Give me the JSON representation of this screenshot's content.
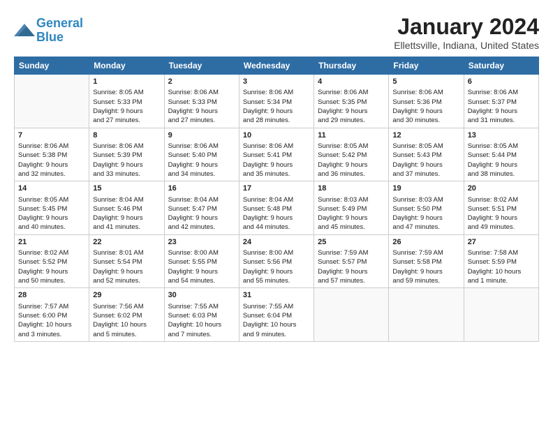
{
  "header": {
    "logo_line1": "General",
    "logo_line2": "Blue",
    "month": "January 2024",
    "location": "Ellettsville, Indiana, United States"
  },
  "weekdays": [
    "Sunday",
    "Monday",
    "Tuesday",
    "Wednesday",
    "Thursday",
    "Friday",
    "Saturday"
  ],
  "weeks": [
    [
      {
        "day": "",
        "text": ""
      },
      {
        "day": "1",
        "text": "Sunrise: 8:05 AM\nSunset: 5:33 PM\nDaylight: 9 hours\nand 27 minutes."
      },
      {
        "day": "2",
        "text": "Sunrise: 8:06 AM\nSunset: 5:33 PM\nDaylight: 9 hours\nand 27 minutes."
      },
      {
        "day": "3",
        "text": "Sunrise: 8:06 AM\nSunset: 5:34 PM\nDaylight: 9 hours\nand 28 minutes."
      },
      {
        "day": "4",
        "text": "Sunrise: 8:06 AM\nSunset: 5:35 PM\nDaylight: 9 hours\nand 29 minutes."
      },
      {
        "day": "5",
        "text": "Sunrise: 8:06 AM\nSunset: 5:36 PM\nDaylight: 9 hours\nand 30 minutes."
      },
      {
        "day": "6",
        "text": "Sunrise: 8:06 AM\nSunset: 5:37 PM\nDaylight: 9 hours\nand 31 minutes."
      }
    ],
    [
      {
        "day": "7",
        "text": "Sunrise: 8:06 AM\nSunset: 5:38 PM\nDaylight: 9 hours\nand 32 minutes."
      },
      {
        "day": "8",
        "text": "Sunrise: 8:06 AM\nSunset: 5:39 PM\nDaylight: 9 hours\nand 33 minutes."
      },
      {
        "day": "9",
        "text": "Sunrise: 8:06 AM\nSunset: 5:40 PM\nDaylight: 9 hours\nand 34 minutes."
      },
      {
        "day": "10",
        "text": "Sunrise: 8:06 AM\nSunset: 5:41 PM\nDaylight: 9 hours\nand 35 minutes."
      },
      {
        "day": "11",
        "text": "Sunrise: 8:05 AM\nSunset: 5:42 PM\nDaylight: 9 hours\nand 36 minutes."
      },
      {
        "day": "12",
        "text": "Sunrise: 8:05 AM\nSunset: 5:43 PM\nDaylight: 9 hours\nand 37 minutes."
      },
      {
        "day": "13",
        "text": "Sunrise: 8:05 AM\nSunset: 5:44 PM\nDaylight: 9 hours\nand 38 minutes."
      }
    ],
    [
      {
        "day": "14",
        "text": "Sunrise: 8:05 AM\nSunset: 5:45 PM\nDaylight: 9 hours\nand 40 minutes."
      },
      {
        "day": "15",
        "text": "Sunrise: 8:04 AM\nSunset: 5:46 PM\nDaylight: 9 hours\nand 41 minutes."
      },
      {
        "day": "16",
        "text": "Sunrise: 8:04 AM\nSunset: 5:47 PM\nDaylight: 9 hours\nand 42 minutes."
      },
      {
        "day": "17",
        "text": "Sunrise: 8:04 AM\nSunset: 5:48 PM\nDaylight: 9 hours\nand 44 minutes."
      },
      {
        "day": "18",
        "text": "Sunrise: 8:03 AM\nSunset: 5:49 PM\nDaylight: 9 hours\nand 45 minutes."
      },
      {
        "day": "19",
        "text": "Sunrise: 8:03 AM\nSunset: 5:50 PM\nDaylight: 9 hours\nand 47 minutes."
      },
      {
        "day": "20",
        "text": "Sunrise: 8:02 AM\nSunset: 5:51 PM\nDaylight: 9 hours\nand 49 minutes."
      }
    ],
    [
      {
        "day": "21",
        "text": "Sunrise: 8:02 AM\nSunset: 5:52 PM\nDaylight: 9 hours\nand 50 minutes."
      },
      {
        "day": "22",
        "text": "Sunrise: 8:01 AM\nSunset: 5:54 PM\nDaylight: 9 hours\nand 52 minutes."
      },
      {
        "day": "23",
        "text": "Sunrise: 8:00 AM\nSunset: 5:55 PM\nDaylight: 9 hours\nand 54 minutes."
      },
      {
        "day": "24",
        "text": "Sunrise: 8:00 AM\nSunset: 5:56 PM\nDaylight: 9 hours\nand 55 minutes."
      },
      {
        "day": "25",
        "text": "Sunrise: 7:59 AM\nSunset: 5:57 PM\nDaylight: 9 hours\nand 57 minutes."
      },
      {
        "day": "26",
        "text": "Sunrise: 7:59 AM\nSunset: 5:58 PM\nDaylight: 9 hours\nand 59 minutes."
      },
      {
        "day": "27",
        "text": "Sunrise: 7:58 AM\nSunset: 5:59 PM\nDaylight: 10 hours\nand 1 minute."
      }
    ],
    [
      {
        "day": "28",
        "text": "Sunrise: 7:57 AM\nSunset: 6:00 PM\nDaylight: 10 hours\nand 3 minutes."
      },
      {
        "day": "29",
        "text": "Sunrise: 7:56 AM\nSunset: 6:02 PM\nDaylight: 10 hours\nand 5 minutes."
      },
      {
        "day": "30",
        "text": "Sunrise: 7:55 AM\nSunset: 6:03 PM\nDaylight: 10 hours\nand 7 minutes."
      },
      {
        "day": "31",
        "text": "Sunrise: 7:55 AM\nSunset: 6:04 PM\nDaylight: 10 hours\nand 9 minutes."
      },
      {
        "day": "",
        "text": ""
      },
      {
        "day": "",
        "text": ""
      },
      {
        "day": "",
        "text": ""
      }
    ]
  ]
}
